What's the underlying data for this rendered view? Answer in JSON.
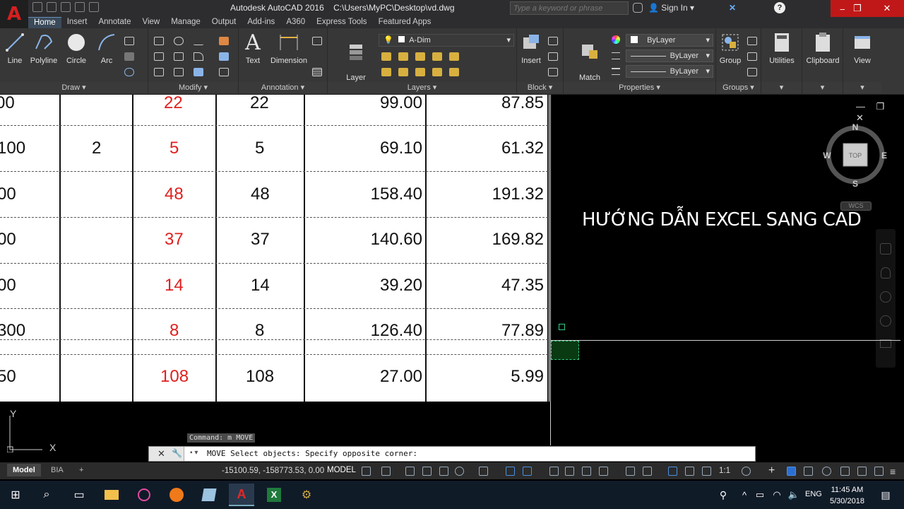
{
  "titlebar": {
    "app_title": "Autodesk AutoCAD 2016",
    "file_path": "C:\\Users\\MyPC\\Desktop\\vd.dwg",
    "search_placeholder": "Type a keyword or phrase",
    "sign_in": "Sign In",
    "app_icon": "A",
    "minimize": "—",
    "maximize": "❐",
    "close": "✕"
  },
  "ribbon_tabs": [
    "Home",
    "Insert",
    "Annotate",
    "View",
    "Manage",
    "Output",
    "Add-ins",
    "A360",
    "Express Tools",
    "Featured Apps"
  ],
  "ribbon": {
    "draw": {
      "title": "Draw",
      "line": "Line",
      "polyline": "Polyline",
      "circle": "Circle",
      "arc": "Arc"
    },
    "modify": {
      "title": "Modify"
    },
    "annotation": {
      "title": "Annotation",
      "text": "Text",
      "dimension": "Dimension"
    },
    "layers": {
      "title": "Layers",
      "layer_properties": "Layer\nProperties",
      "current_layer": "A-Dim"
    },
    "block": {
      "title": "Block",
      "insert": "Insert"
    },
    "properties": {
      "title": "Properties",
      "match": "Match\nProperties",
      "color": "ByLayer",
      "linetype": "ByLayer",
      "lineweight": "ByLayer"
    },
    "groups": {
      "title": "Groups",
      "group": "Group"
    },
    "utilities": "Utilities",
    "clipboard": "Clipboard",
    "view": "View"
  },
  "table": {
    "rows": [
      {
        "c1": "00",
        "c2": "",
        "c3": "22",
        "c4": "22",
        "c5": "99.00",
        "c6": "87.85"
      },
      {
        "c1": "100",
        "c2": "2",
        "c3": "5",
        "c4": "5",
        "c5": "69.10",
        "c6": "61.32"
      },
      {
        "c1": "00",
        "c2": "",
        "c3": "48",
        "c4": "48",
        "c5": "158.40",
        "c6": "191.32"
      },
      {
        "c1": "00",
        "c2": "",
        "c3": "37",
        "c4": "37",
        "c5": "140.60",
        "c6": "169.82"
      },
      {
        "c1": "00",
        "c2": "",
        "c3": "14",
        "c4": "14",
        "c5": "39.20",
        "c6": "47.35"
      },
      {
        "c1": "300",
        "c2": "",
        "c3": "8",
        "c4": "8",
        "c5": "126.40",
        "c6": "77.89"
      },
      {
        "c1": "50",
        "c2": "",
        "c3": "108",
        "c4": "108",
        "c5": "27.00",
        "c6": "5.99"
      }
    ]
  },
  "viewport": {
    "title": "HƯỚNG DẪN EXCEL SANG CAD",
    "viewcube": {
      "top": "TOP",
      "n": "N",
      "s": "S",
      "e": "E",
      "w": "W",
      "wcs": "WCS"
    },
    "ucs_x": "X",
    "ucs_y": "Y",
    "controls": "— ❐ ✕"
  },
  "command": {
    "history": "Command: m MOVE",
    "prompt": "MOVE Select objects: Specify opposite corner:"
  },
  "layout_tabs": [
    "Model",
    "BIA"
  ],
  "layout_add": "+",
  "statusbar": {
    "coords": "-15100.59, -158773.53, 0.00",
    "model": "MODEL",
    "scale": "1:1"
  },
  "taskbar": {
    "time": "11:45 AM",
    "date": "5/30/2018",
    "lang": "ENG"
  }
}
